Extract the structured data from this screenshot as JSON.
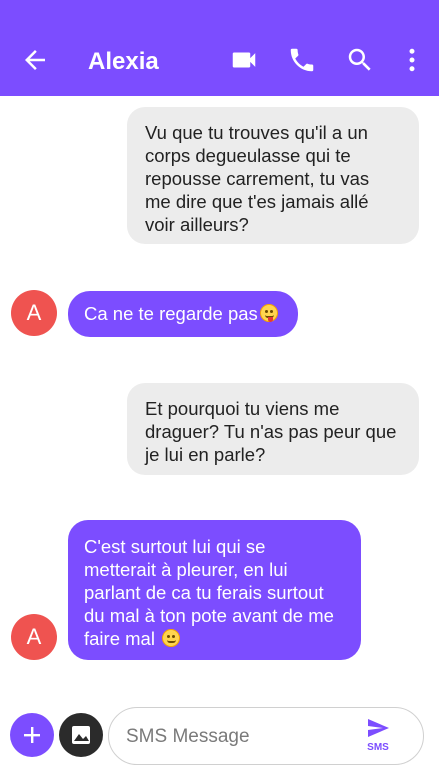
{
  "header": {
    "contact_name": "Alexia",
    "icons": [
      "back-arrow-icon",
      "video-call-icon",
      "phone-icon",
      "search-icon",
      "more-vert-icon"
    ]
  },
  "messages": [
    {
      "direction": "outgoing",
      "lines": [
        "Vu que tu trouves qu'il a un",
        "corps degueulasse qui te",
        "repousse carrement, tu vas",
        "me dire que t'es jamais allé",
        "voir ailleurs?"
      ]
    },
    {
      "direction": "incoming",
      "avatar_letter": "A",
      "lines": [
        "Ca ne te regarde pas"
      ],
      "emoji": "face-with-tongue"
    },
    {
      "direction": "outgoing",
      "lines": [
        "Et pourquoi tu viens me",
        "draguer? Tu n'as pas peur que",
        "je lui en parle?"
      ]
    },
    {
      "direction": "incoming",
      "avatar_letter": "A",
      "lines": [
        "C'est surtout lui qui se",
        "metterait à pleurer, en lui",
        "parlant de ca tu ferais surtout",
        "du mal à ton pote avant de me",
        "faire mal"
      ],
      "emoji": "relieved-face"
    }
  ],
  "composer": {
    "placeholder": "SMS Message",
    "send_label": "SMS"
  },
  "colors": {
    "accent": "#7c4dff",
    "avatar": "#ef5350",
    "outgoing_bubble": "#ececec"
  }
}
